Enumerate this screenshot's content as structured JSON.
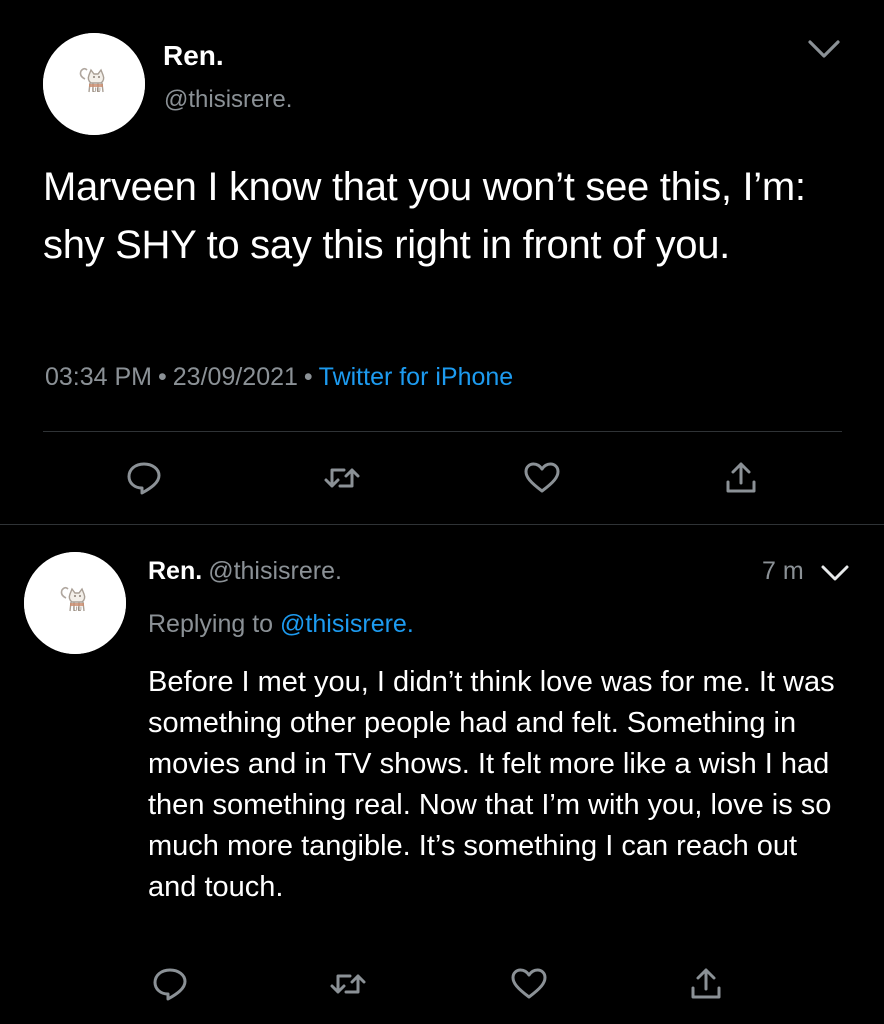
{
  "main_tweet": {
    "author_name": "Ren.",
    "author_handle": "@thisisrere.",
    "text": "Marveen I know that you won’t see this, I’m: shy SHY to say this right in front of you.",
    "time": "03:34 PM",
    "date": "23/09/2021",
    "client": "Twitter for iPhone",
    "separator": "•",
    "actions": [
      "reply-icon",
      "retweet-icon",
      "like-icon",
      "share-icon"
    ]
  },
  "reply_tweet": {
    "author_name": "Ren.",
    "author_handle": "@thisisrere.",
    "time_ago": "7 m",
    "replying_prefix": "Replying to",
    "replying_to": "@thisisrere.",
    "text": "Before I met you, I didn’t think love was for me. It was something other people had and felt. Something in movies and in TV shows. It felt more like a wish I had then something real. Now that I’m with you, love is so much more tangible. It’s something I can reach out and touch.",
    "actions": [
      "reply-icon",
      "retweet-icon",
      "like-icon",
      "share-icon"
    ]
  },
  "colors": {
    "background": "#000000",
    "text": "#ffffff",
    "secondary": "#8b9196",
    "accent": "#1d9bf0",
    "divider": "#2f3336"
  }
}
